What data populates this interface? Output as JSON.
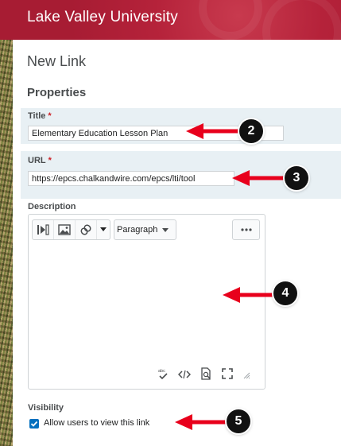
{
  "header": {
    "brand": "Lake Valley University"
  },
  "page": {
    "title": "New Link",
    "section_title": "Properties"
  },
  "fields": {
    "title_label": "Title",
    "title_value": "Elementary Education Lesson Plan",
    "url_label": "URL",
    "url_value": "https://epcs.chalkandwire.com/epcs/lti/tool",
    "required_marker": "*",
    "description_label": "Description"
  },
  "editor": {
    "format_select_value": "Paragraph",
    "icons": [
      "media-insert-icon",
      "image-insert-icon",
      "quicklink-icon",
      "dropdown-caret-icon",
      "more-options-icon",
      "spellcheck-icon",
      "source-code-icon",
      "preview-icon",
      "fullscreen-icon",
      "resize-handle-icon"
    ]
  },
  "visibility": {
    "label": "Visibility",
    "checkbox_label": "Allow users to view this link",
    "checked": true
  },
  "callouts": [
    "2",
    "3",
    "4",
    "5"
  ],
  "colors": {
    "header": "#b01f37",
    "arrow": "#e8001c",
    "field_highlight": "#e8f0f4",
    "checkbox": "#006fbf"
  }
}
